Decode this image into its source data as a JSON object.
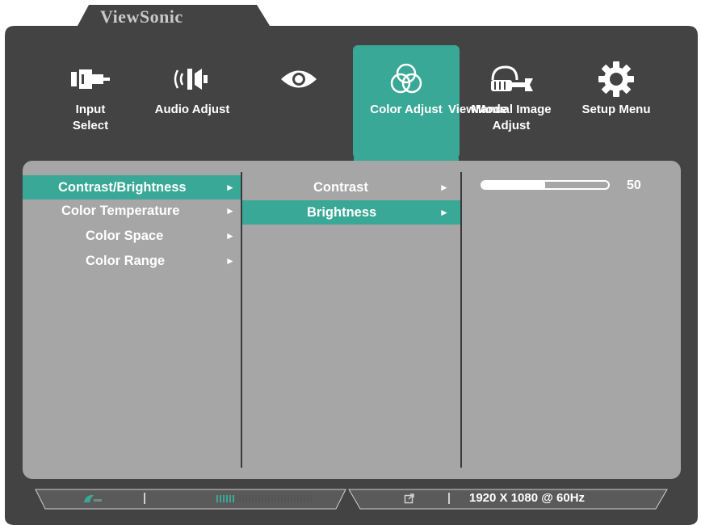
{
  "brand": "ViewSonic",
  "tabs": [
    {
      "label_1": "Input",
      "label_2": "Select",
      "icon": "input-select-icon"
    },
    {
      "label_1": "Audio Adjust",
      "label_2": "",
      "icon": "speaker-icon"
    },
    {
      "label_1": "ViewMode",
      "label_2": "",
      "icon": "eye-icon"
    },
    {
      "label_1": "Color Adjust",
      "label_2": "",
      "icon": "color-circles-icon"
    },
    {
      "label_1": "Manual Image",
      "label_2": "Adjust",
      "icon": "wrench-hand-icon"
    },
    {
      "label_1": "Setup Menu",
      "label_2": "",
      "icon": "gear-icon"
    }
  ],
  "active_tab": "Color Adjust",
  "menu_level1": [
    {
      "label": "Contrast/Brightness",
      "arrow": "►",
      "selected": true
    },
    {
      "label": "Color Temperature",
      "arrow": "►",
      "selected": false
    },
    {
      "label": "Color Space",
      "arrow": "►",
      "selected": false
    },
    {
      "label": "Color Range",
      "arrow": "►",
      "selected": false
    }
  ],
  "menu_level2": [
    {
      "label": "Contrast",
      "arrow": "►",
      "selected": false
    },
    {
      "label": "Brightness",
      "arrow": "►",
      "selected": true
    }
  ],
  "slider": {
    "value": 50,
    "max": 100,
    "value_label": "50"
  },
  "status": {
    "resolution": "1920 X 1080 @ 60Hz",
    "signal_bars_on": 6,
    "signal_bars_total": 30
  },
  "colors": {
    "accent": "#3aa896",
    "frame": "#434343",
    "panel": "#a6a6a6",
    "brand": "#c9c9c9"
  }
}
